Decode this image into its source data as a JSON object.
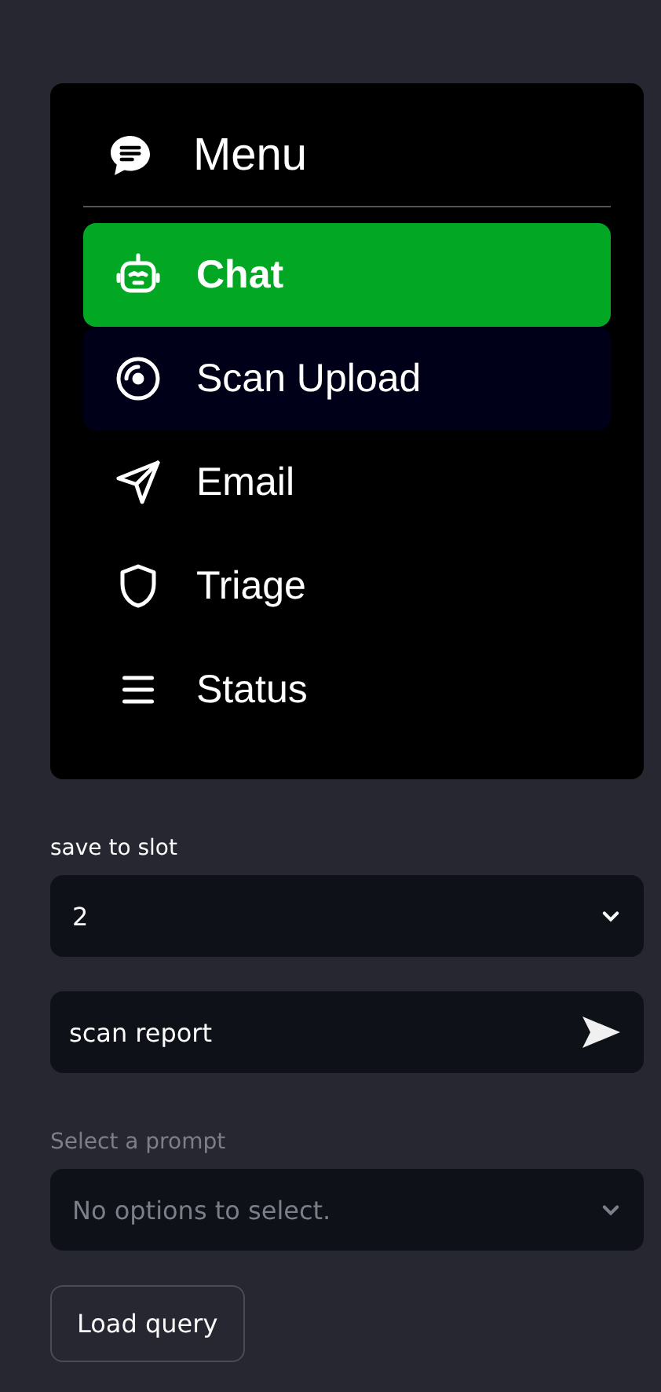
{
  "menu": {
    "title": "Menu",
    "items": [
      {
        "label": "Chat",
        "kind": "robot",
        "selected": true,
        "highlighted": false
      },
      {
        "label": "Scan Upload",
        "kind": "disc",
        "selected": false,
        "highlighted": true
      },
      {
        "label": "Email",
        "kind": "send",
        "selected": false,
        "highlighted": false
      },
      {
        "label": "Triage",
        "kind": "shield",
        "selected": false,
        "highlighted": false
      },
      {
        "label": "Status",
        "kind": "list",
        "selected": false,
        "highlighted": false
      }
    ]
  },
  "slot": {
    "label": "save to slot",
    "value": "2"
  },
  "query": {
    "value": "scan report"
  },
  "prompt": {
    "label": "Select a prompt",
    "placeholder": "No options to select.",
    "disabled": true
  },
  "buttons": [
    "Load query"
  ]
}
